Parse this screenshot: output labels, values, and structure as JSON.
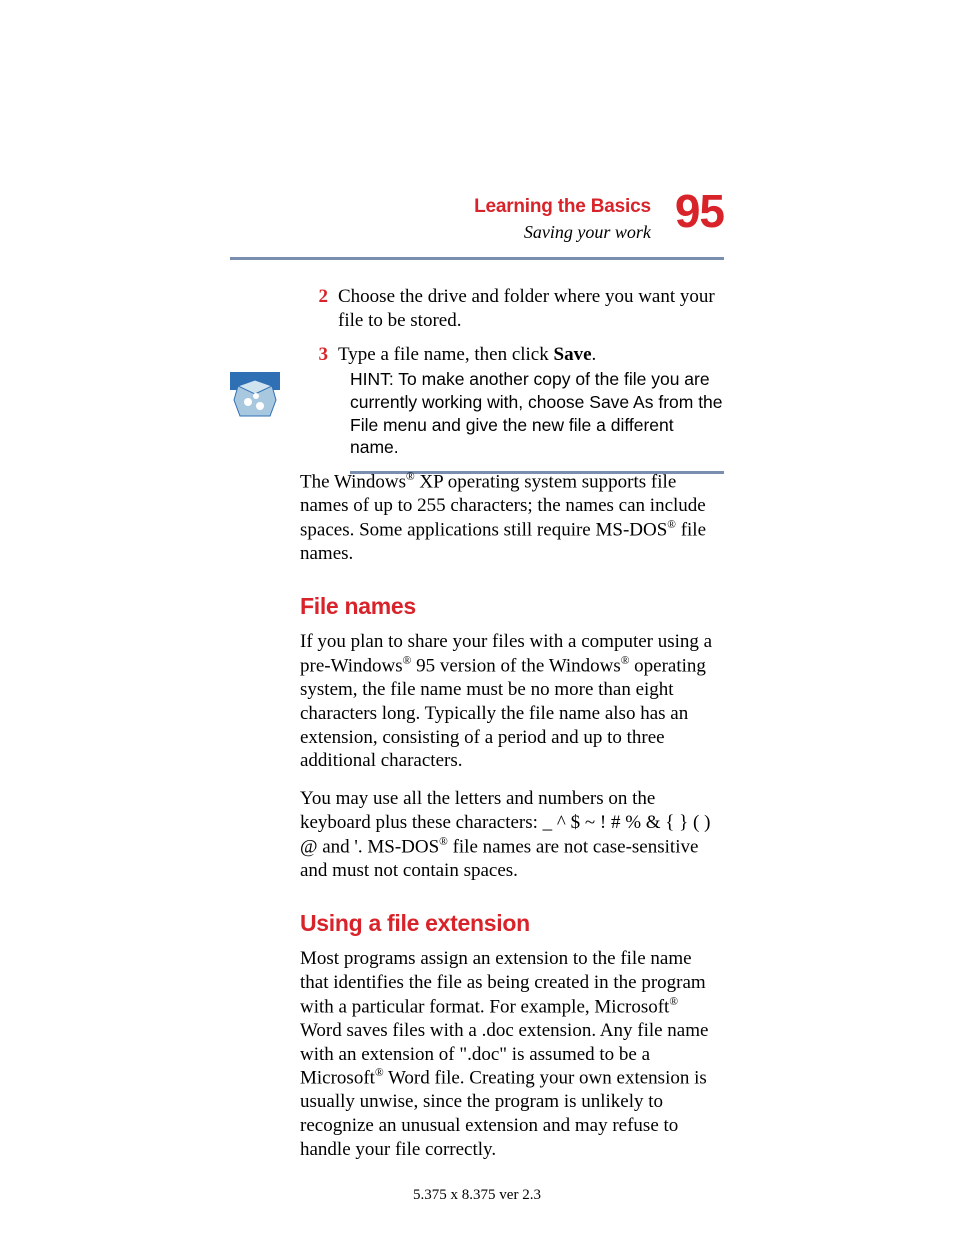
{
  "header": {
    "chapter": "Learning the Basics",
    "section": "Saving your work",
    "page_number": "95"
  },
  "steps": [
    {
      "num": "2",
      "text": "Choose the drive and folder where you want your file to be stored."
    },
    {
      "num": "3",
      "text_pre": "Type a file name, then click ",
      "bold": "Save",
      "text_post": "."
    }
  ],
  "hint": {
    "text": "HINT: To make another copy of the file you are currently working with, choose Save As from the File menu and give the new file a different name."
  },
  "body": {
    "p1_a": "The Windows",
    "p1_b": " XP operating system supports file names of up to 255 characters; the names can include spaces. Some applications still require MS-DOS",
    "p1_c": " file names.",
    "h_filenames": "File names",
    "p2_a": "If you plan to share your files with a computer using a pre-Windows",
    "p2_b": " 95 version of the Windows",
    "p2_c": " operating system, the file name must be no more than eight characters long. Typically the file name also has an extension, consisting of a period and up to three additional characters.",
    "p3_a": "You may use all the letters and numbers on the keyboard plus these characters: _ ^ $ ~ ! # % & { } ( ) @ and '. MS-DOS",
    "p3_b": " file names are not case-sensitive and must not contain spaces.",
    "h_ext": "Using a file extension",
    "p4_a": "Most programs assign an extension to the file name that identifies the file as being created in the program with a particular format. For example, Microsoft",
    "p4_b": " Word saves files with a .doc extension. Any file name with an extension of \".doc\" is assumed to be a Microsoft",
    "p4_c": " Word file. Creating your own extension is usually unwise, since the program is unlikely to recognize an unusual extension and may refuse to handle your file correctly."
  },
  "footer": "5.375 x 8.375 ver 2.3",
  "reg": "®"
}
